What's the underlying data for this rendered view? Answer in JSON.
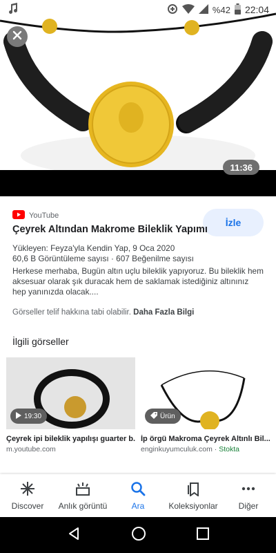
{
  "status_bar": {
    "battery": "%42",
    "time": "22:04",
    "icons": [
      "music-note-icon",
      "data-saver-icon",
      "wifi-icon",
      "signal-icon",
      "battery-icon"
    ]
  },
  "hero": {
    "duration": "11:36",
    "close_icon": "close-icon"
  },
  "result": {
    "source": "YouTube",
    "title": "Çeyrek Altından Makrome Bileklik Yapımı",
    "watch_label": "İzle",
    "uploader": "Yükleyen: Feyza'yla Kendin Yap, 9 Oca 2020",
    "stats": "60,6 B Görüntüleme sayısı  ·  607 Beğenilme sayısı",
    "description": "Herkese merhaba, Bugün altın uçlu bileklik yapıyoruz. Bu bileklik hem aksesuar olarak şık duracak hem de saklamak istediğiniz altınınız hep yanınızda olacak....",
    "copyright_text": "Görseller telif hakkına tabi olabilir.",
    "more_info": "Daha Fazla Bilgi"
  },
  "related": {
    "title": "İlgili görseller",
    "items": [
      {
        "caption": "Çeyrek ipi bileklik yapılışı guarter b...",
        "source": "m.youtube.com",
        "badge": "19:30",
        "badge_icon": "play-icon"
      },
      {
        "caption": "İp örgü Makroma Çeyrek Altınlı Bil...",
        "source": "enginkuyumculuk.com",
        "stock": "Stokta",
        "badge": "Ürün",
        "badge_icon": "tag-icon"
      }
    ]
  },
  "bottom_nav": {
    "items": [
      {
        "label": "Discover",
        "icon": "asterisk-icon"
      },
      {
        "label": "Anlık görüntü",
        "icon": "snapshot-icon"
      },
      {
        "label": "Ara",
        "icon": "search-icon"
      },
      {
        "label": "Koleksiyonlar",
        "icon": "bookmarks-icon"
      },
      {
        "label": "Diğer",
        "icon": "more-icon"
      }
    ],
    "active_color": "#1a73e8"
  },
  "system_nav": [
    "back-icon",
    "home-icon",
    "recents-icon"
  ]
}
